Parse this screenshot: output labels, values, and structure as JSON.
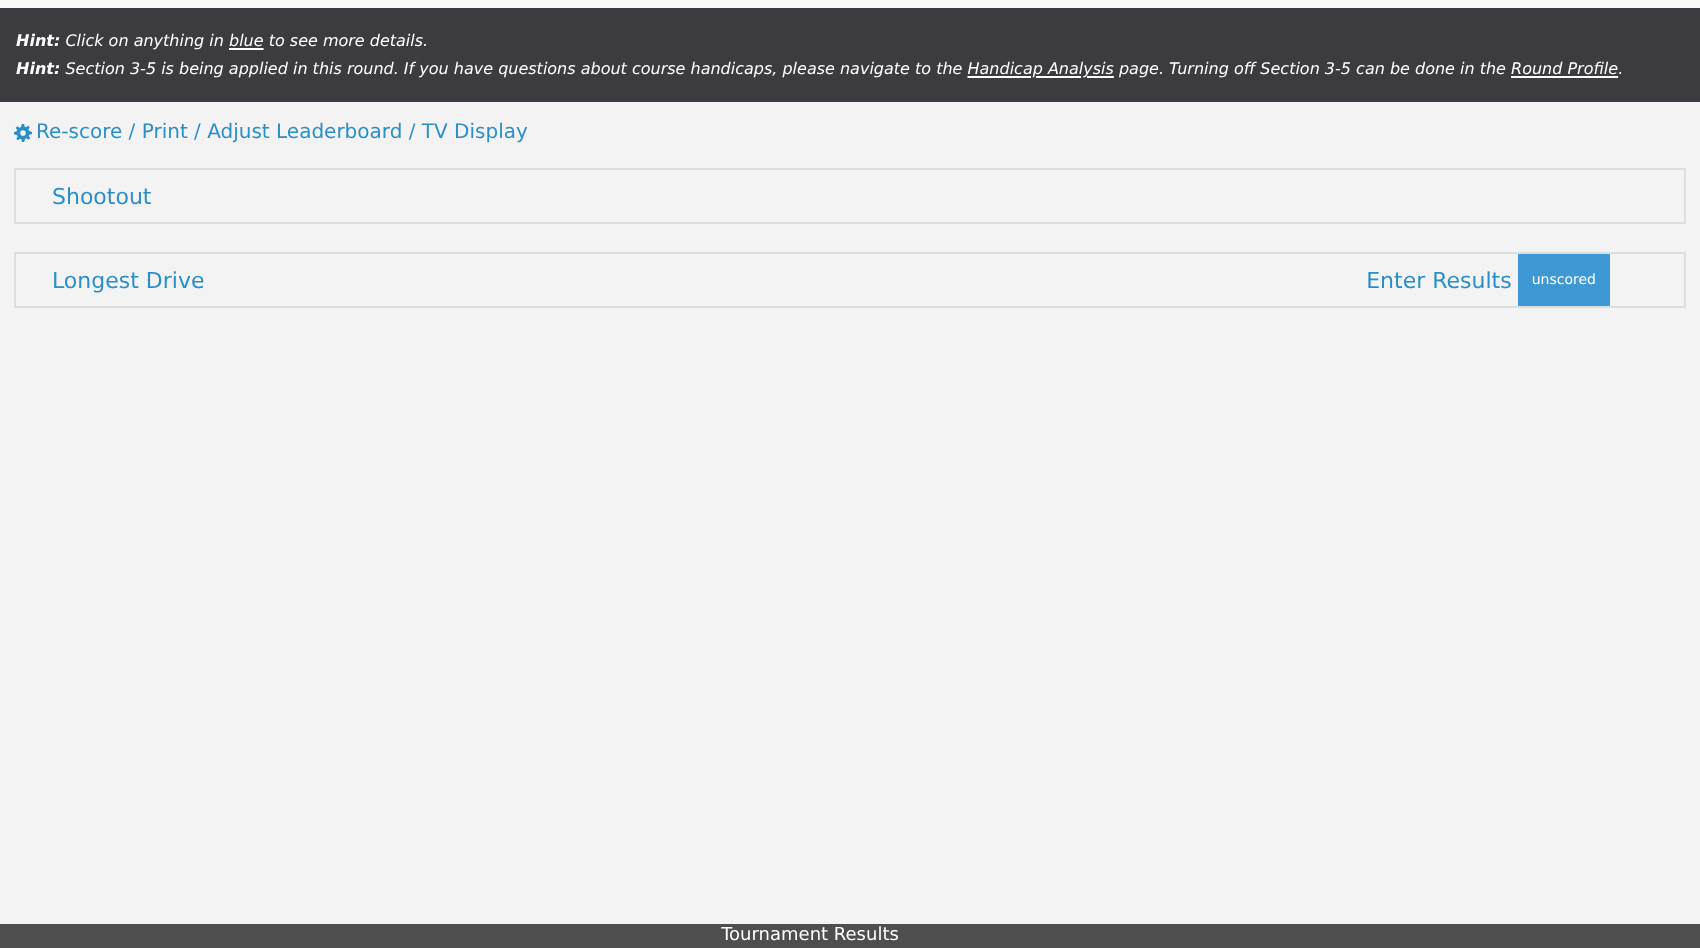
{
  "hints": [
    {
      "label": "Hint:",
      "parts": [
        {
          "kind": "text",
          "text": " Click on anything in "
        },
        {
          "kind": "link",
          "text": "blue"
        },
        {
          "kind": "text",
          "text": " to see more details."
        }
      ]
    },
    {
      "label": "Hint:",
      "parts": [
        {
          "kind": "text",
          "text": " Section 3-5 is being applied in this round. If you have questions about course handicaps, please navigate to the "
        },
        {
          "kind": "link",
          "text": "Handicap Analysis"
        },
        {
          "kind": "text",
          "text": " page. Turning off Section 3-5 can be done in the "
        },
        {
          "kind": "link",
          "text": "Round Profile"
        },
        {
          "kind": "text",
          "text": "."
        }
      ]
    }
  ],
  "toolbar": {
    "link": "Re-score / Print / Adjust Leaderboard / TV Display"
  },
  "events": [
    {
      "name": "Shootout"
    },
    {
      "name": "Longest Drive",
      "action": "Enter Results",
      "status": "unscored"
    }
  ],
  "footer": {
    "title": "Tournament Results"
  }
}
